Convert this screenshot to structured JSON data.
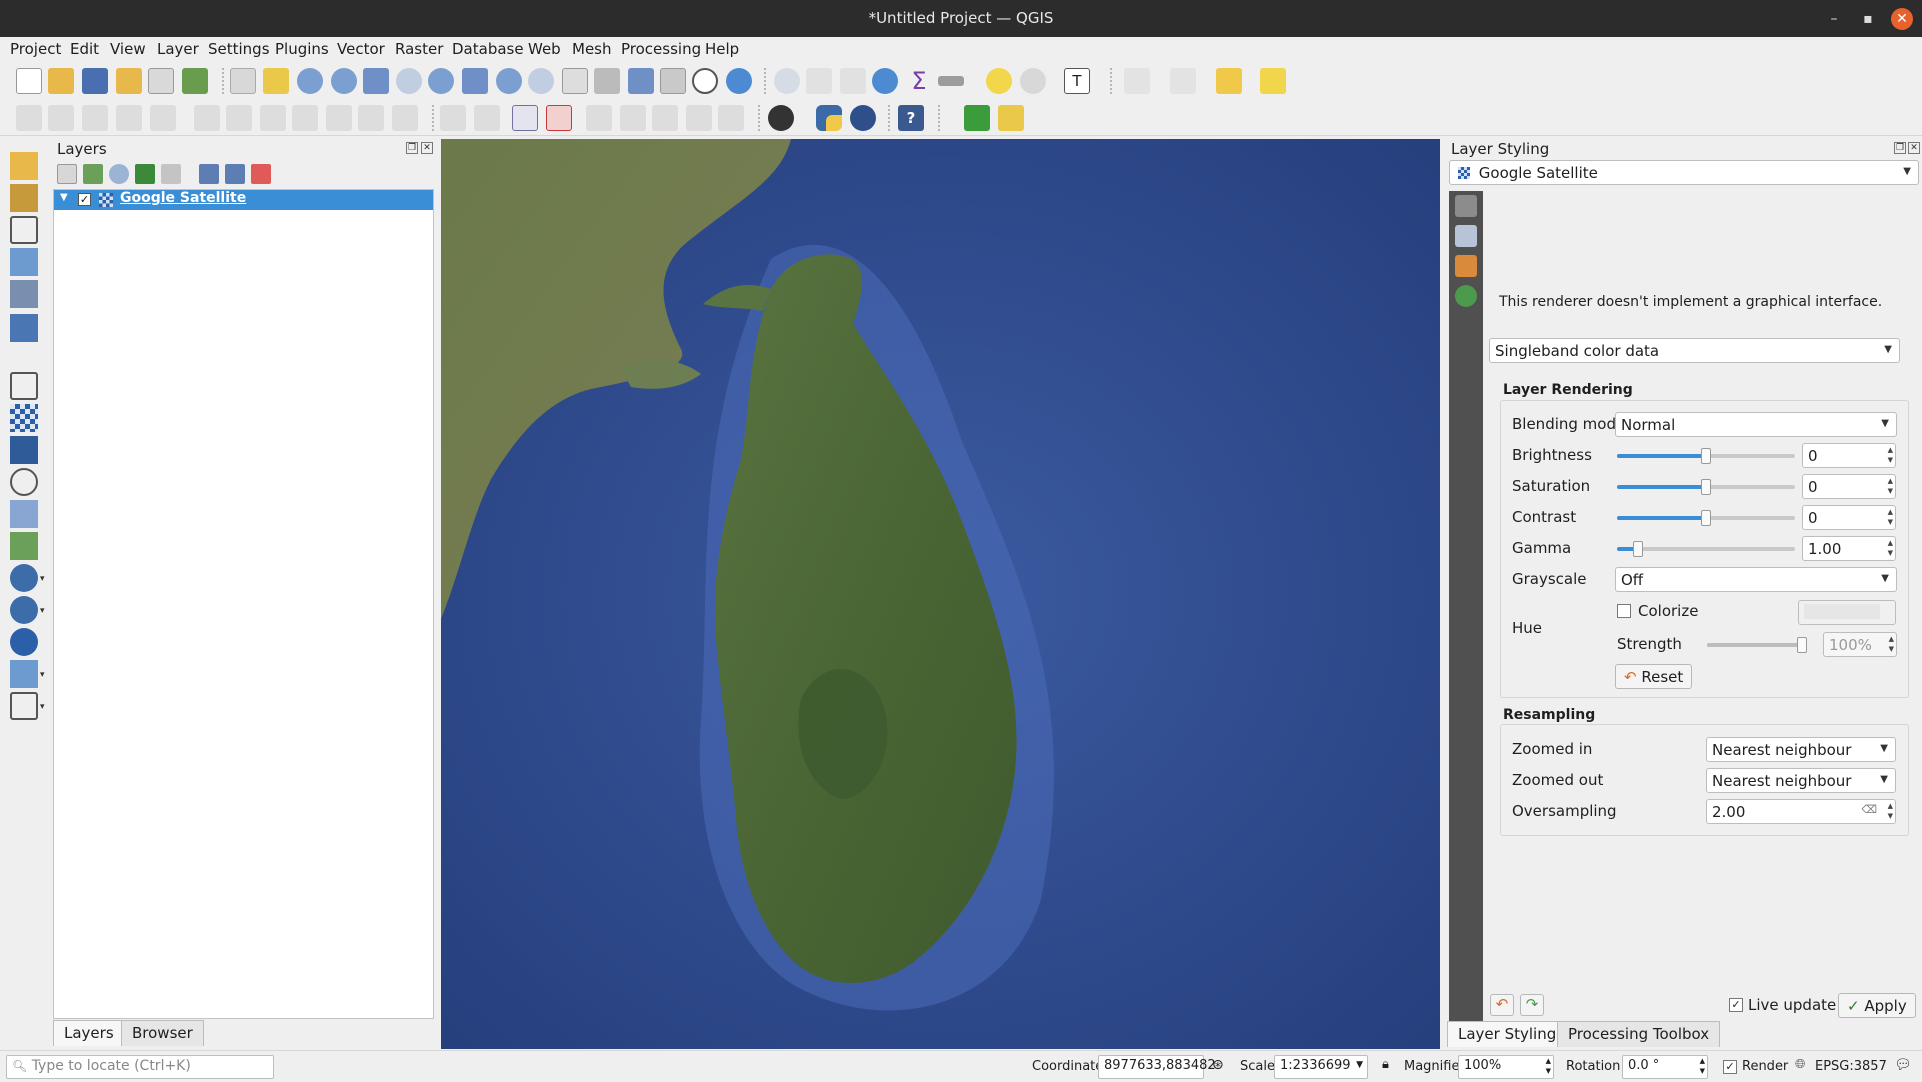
{
  "window": {
    "title": "*Untitled Project — QGIS",
    "minimize": "–",
    "maximize": "▪",
    "close": "✕"
  },
  "menu": [
    "Project",
    "Edit",
    "View",
    "Layer",
    "Settings",
    "Plugins",
    "Vector",
    "Raster",
    "Database",
    "Web",
    "Mesh",
    "Processing",
    "Help"
  ],
  "layers_panel": {
    "title": "Layers",
    "layers": [
      {
        "name": "Google Satellite",
        "checked": true,
        "check_mark": "✓"
      }
    ],
    "tabs": [
      "Layers",
      "Browser"
    ]
  },
  "styling": {
    "title": "Layer Styling",
    "layer_select": "Google Satellite",
    "renderer": "Singleband color data",
    "message": "This renderer doesn't implement a graphical interface.",
    "layer_rendering": {
      "title": "Layer Rendering",
      "blending_label": "Blending mode",
      "blending_value": "Normal",
      "brightness_label": "Brightness",
      "brightness_value": "0",
      "saturation_label": "Saturation",
      "saturation_value": "0",
      "contrast_label": "Contrast",
      "contrast_value": "0",
      "gamma_label": "Gamma",
      "gamma_value": "1.00",
      "grayscale_label": "Grayscale",
      "grayscale_value": "Off",
      "hue_label": "Hue",
      "colorize_label": "Colorize",
      "strength_label": "Strength",
      "strength_value": "100%",
      "reset_label": "Reset"
    },
    "resampling": {
      "title": "Resampling",
      "zoomed_in_label": "Zoomed in",
      "zoomed_in_value": "Nearest neighbour",
      "zoomed_out_label": "Zoomed out",
      "zoomed_out_value": "Nearest neighbour",
      "oversampling_label": "Oversampling",
      "oversampling_value": "2.00"
    },
    "live_update_label": "Live update",
    "apply_label": "Apply",
    "tabs": [
      "Layer Styling",
      "Processing Toolbox"
    ]
  },
  "statusbar": {
    "locator_placeholder": "Type to locate (Ctrl+K)",
    "coordinate_label": "Coordinate",
    "coordinate_value": "8977633,883482",
    "scale_label": "Scale",
    "scale_value": "1:2336699",
    "magnifier_label": "Magnifier",
    "magnifier_value": "100%",
    "rotation_label": "Rotation",
    "rotation_value": "0.0 °",
    "render_label": "Render",
    "crs": "EPSG:3857"
  },
  "colors": {
    "selection": "#3a8ed6",
    "ocean": "#2f4a8a",
    "land": "#4d6a3a",
    "titlebar": "#2c2c2c"
  }
}
